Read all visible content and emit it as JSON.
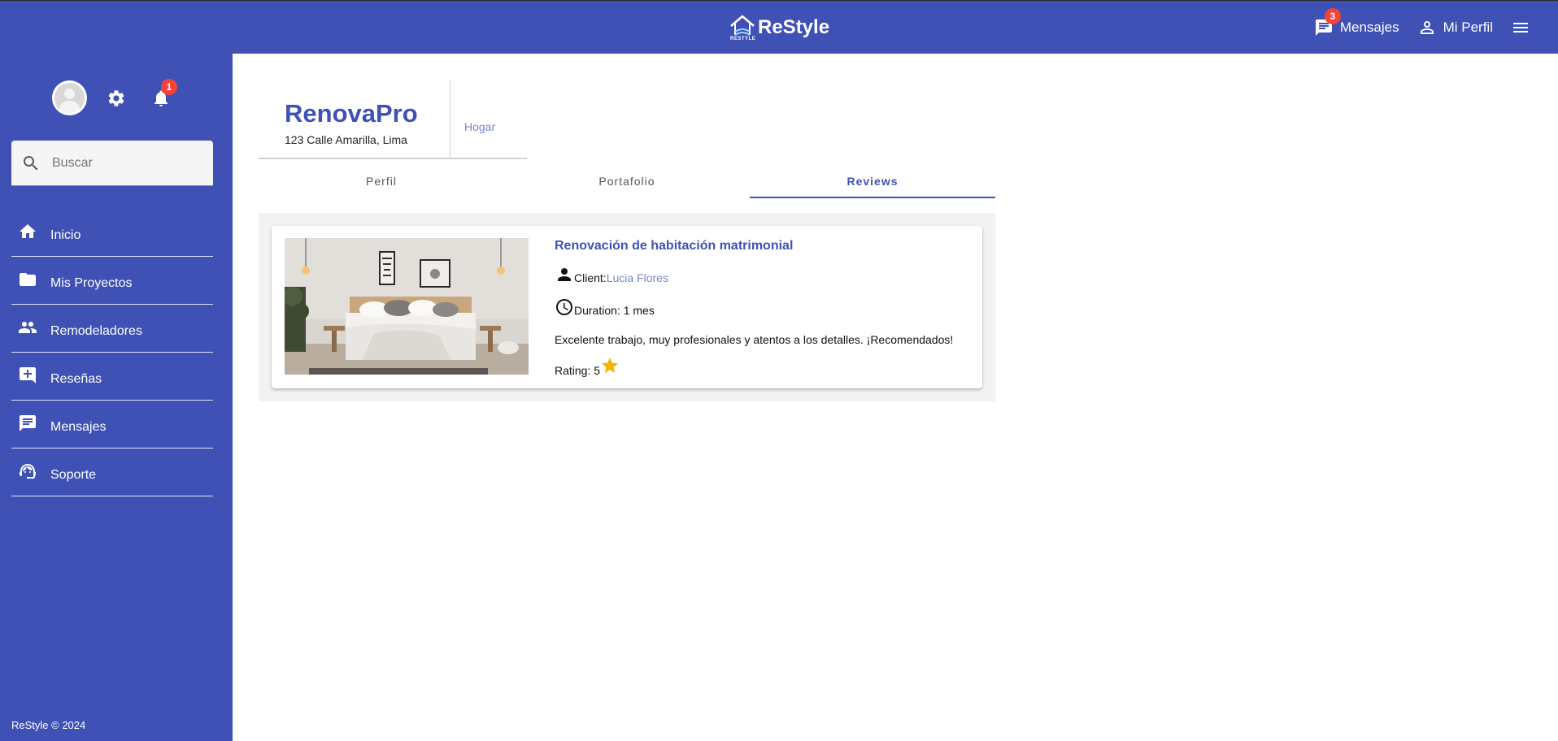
{
  "header": {
    "brand_name": "ReStyle",
    "brand_logo_text": "RESTYLE",
    "messages_label": "Mensajes",
    "messages_count": "3",
    "profile_label": "Mi Perfil"
  },
  "sidebar": {
    "notifications_count": "1",
    "search_placeholder": "Buscar",
    "items": [
      {
        "label": "Inicio",
        "icon": "home-icon"
      },
      {
        "label": "Mis Proyectos",
        "icon": "folder-icon"
      },
      {
        "label": "Remodeladores",
        "icon": "people-icon"
      },
      {
        "label": "Reseñas",
        "icon": "add-comment-icon"
      },
      {
        "label": "Mensajes",
        "icon": "chat-icon"
      },
      {
        "label": "Soporte",
        "icon": "support-agent-icon"
      }
    ],
    "footer": "ReStyle © 2024"
  },
  "profile": {
    "company_name": "RenovaPro",
    "address": "123 Calle Amarilla, Lima",
    "category": "Hogar"
  },
  "tabs": [
    {
      "label": "Perfil"
    },
    {
      "label": "Portafolio"
    },
    {
      "label": "Reviews",
      "active": true
    }
  ],
  "review": {
    "title": "Renovación de habitación matrimonial",
    "client_label": "Client:",
    "client_name": "Lucia Flores",
    "duration_label": "Duration: 1 mes",
    "text": "Excelente trabajo, muy profesionales y atentos a los detalles. ¡Recomendados!",
    "rating_label": "Rating: 5",
    "rating_value": 5
  },
  "colors": {
    "primary": "#3f51b5",
    "accent_link": "#7986cb",
    "badge": "#f44336",
    "star": "#f4b400"
  }
}
